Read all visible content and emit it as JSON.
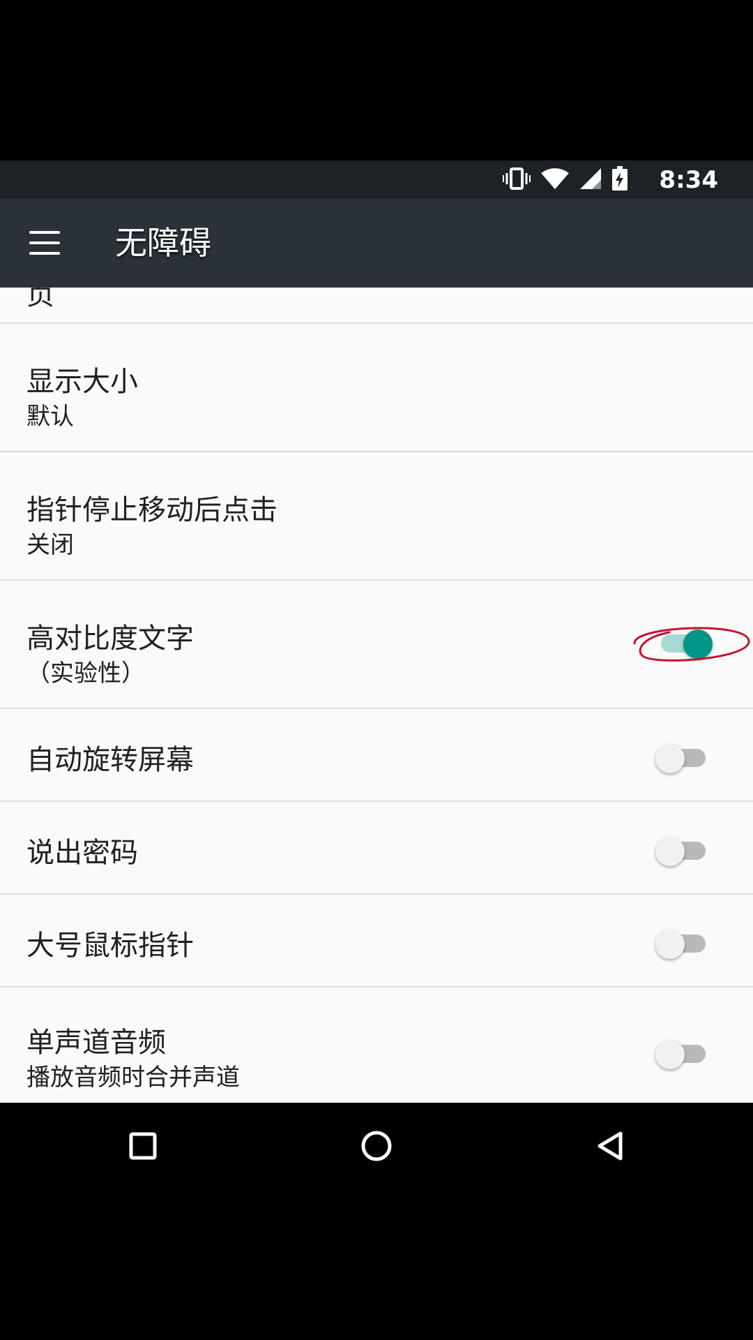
{
  "status_bar": {
    "time": "8:34"
  },
  "app_bar": {
    "title": "无障碍"
  },
  "settings": [
    {
      "title": "显示大小",
      "summary": "默认"
    },
    {
      "title": "指针停止移动后点击",
      "summary": "关闭"
    },
    {
      "title": "高对比度文字",
      "summary": "（实验性）",
      "toggle_on": true
    },
    {
      "title": "自动旋转屏幕",
      "toggle_on": false
    },
    {
      "title": "说出密码",
      "toggle_on": false
    },
    {
      "title": "大号鼠标指针",
      "toggle_on": false
    },
    {
      "title": "单声道音频",
      "summary": "播放音频时合并声道",
      "toggle_on": false
    }
  ],
  "colors": {
    "accent": "#009688",
    "app_bar": "#2a3138",
    "status_bar": "#1d2227",
    "annotation": "#c8102e"
  },
  "icons": {
    "status": [
      "vibrate-icon",
      "wifi-icon",
      "cell-signal-icon",
      "battery-charging-icon"
    ],
    "nav": [
      "recents-icon",
      "home-icon",
      "back-icon"
    ]
  }
}
